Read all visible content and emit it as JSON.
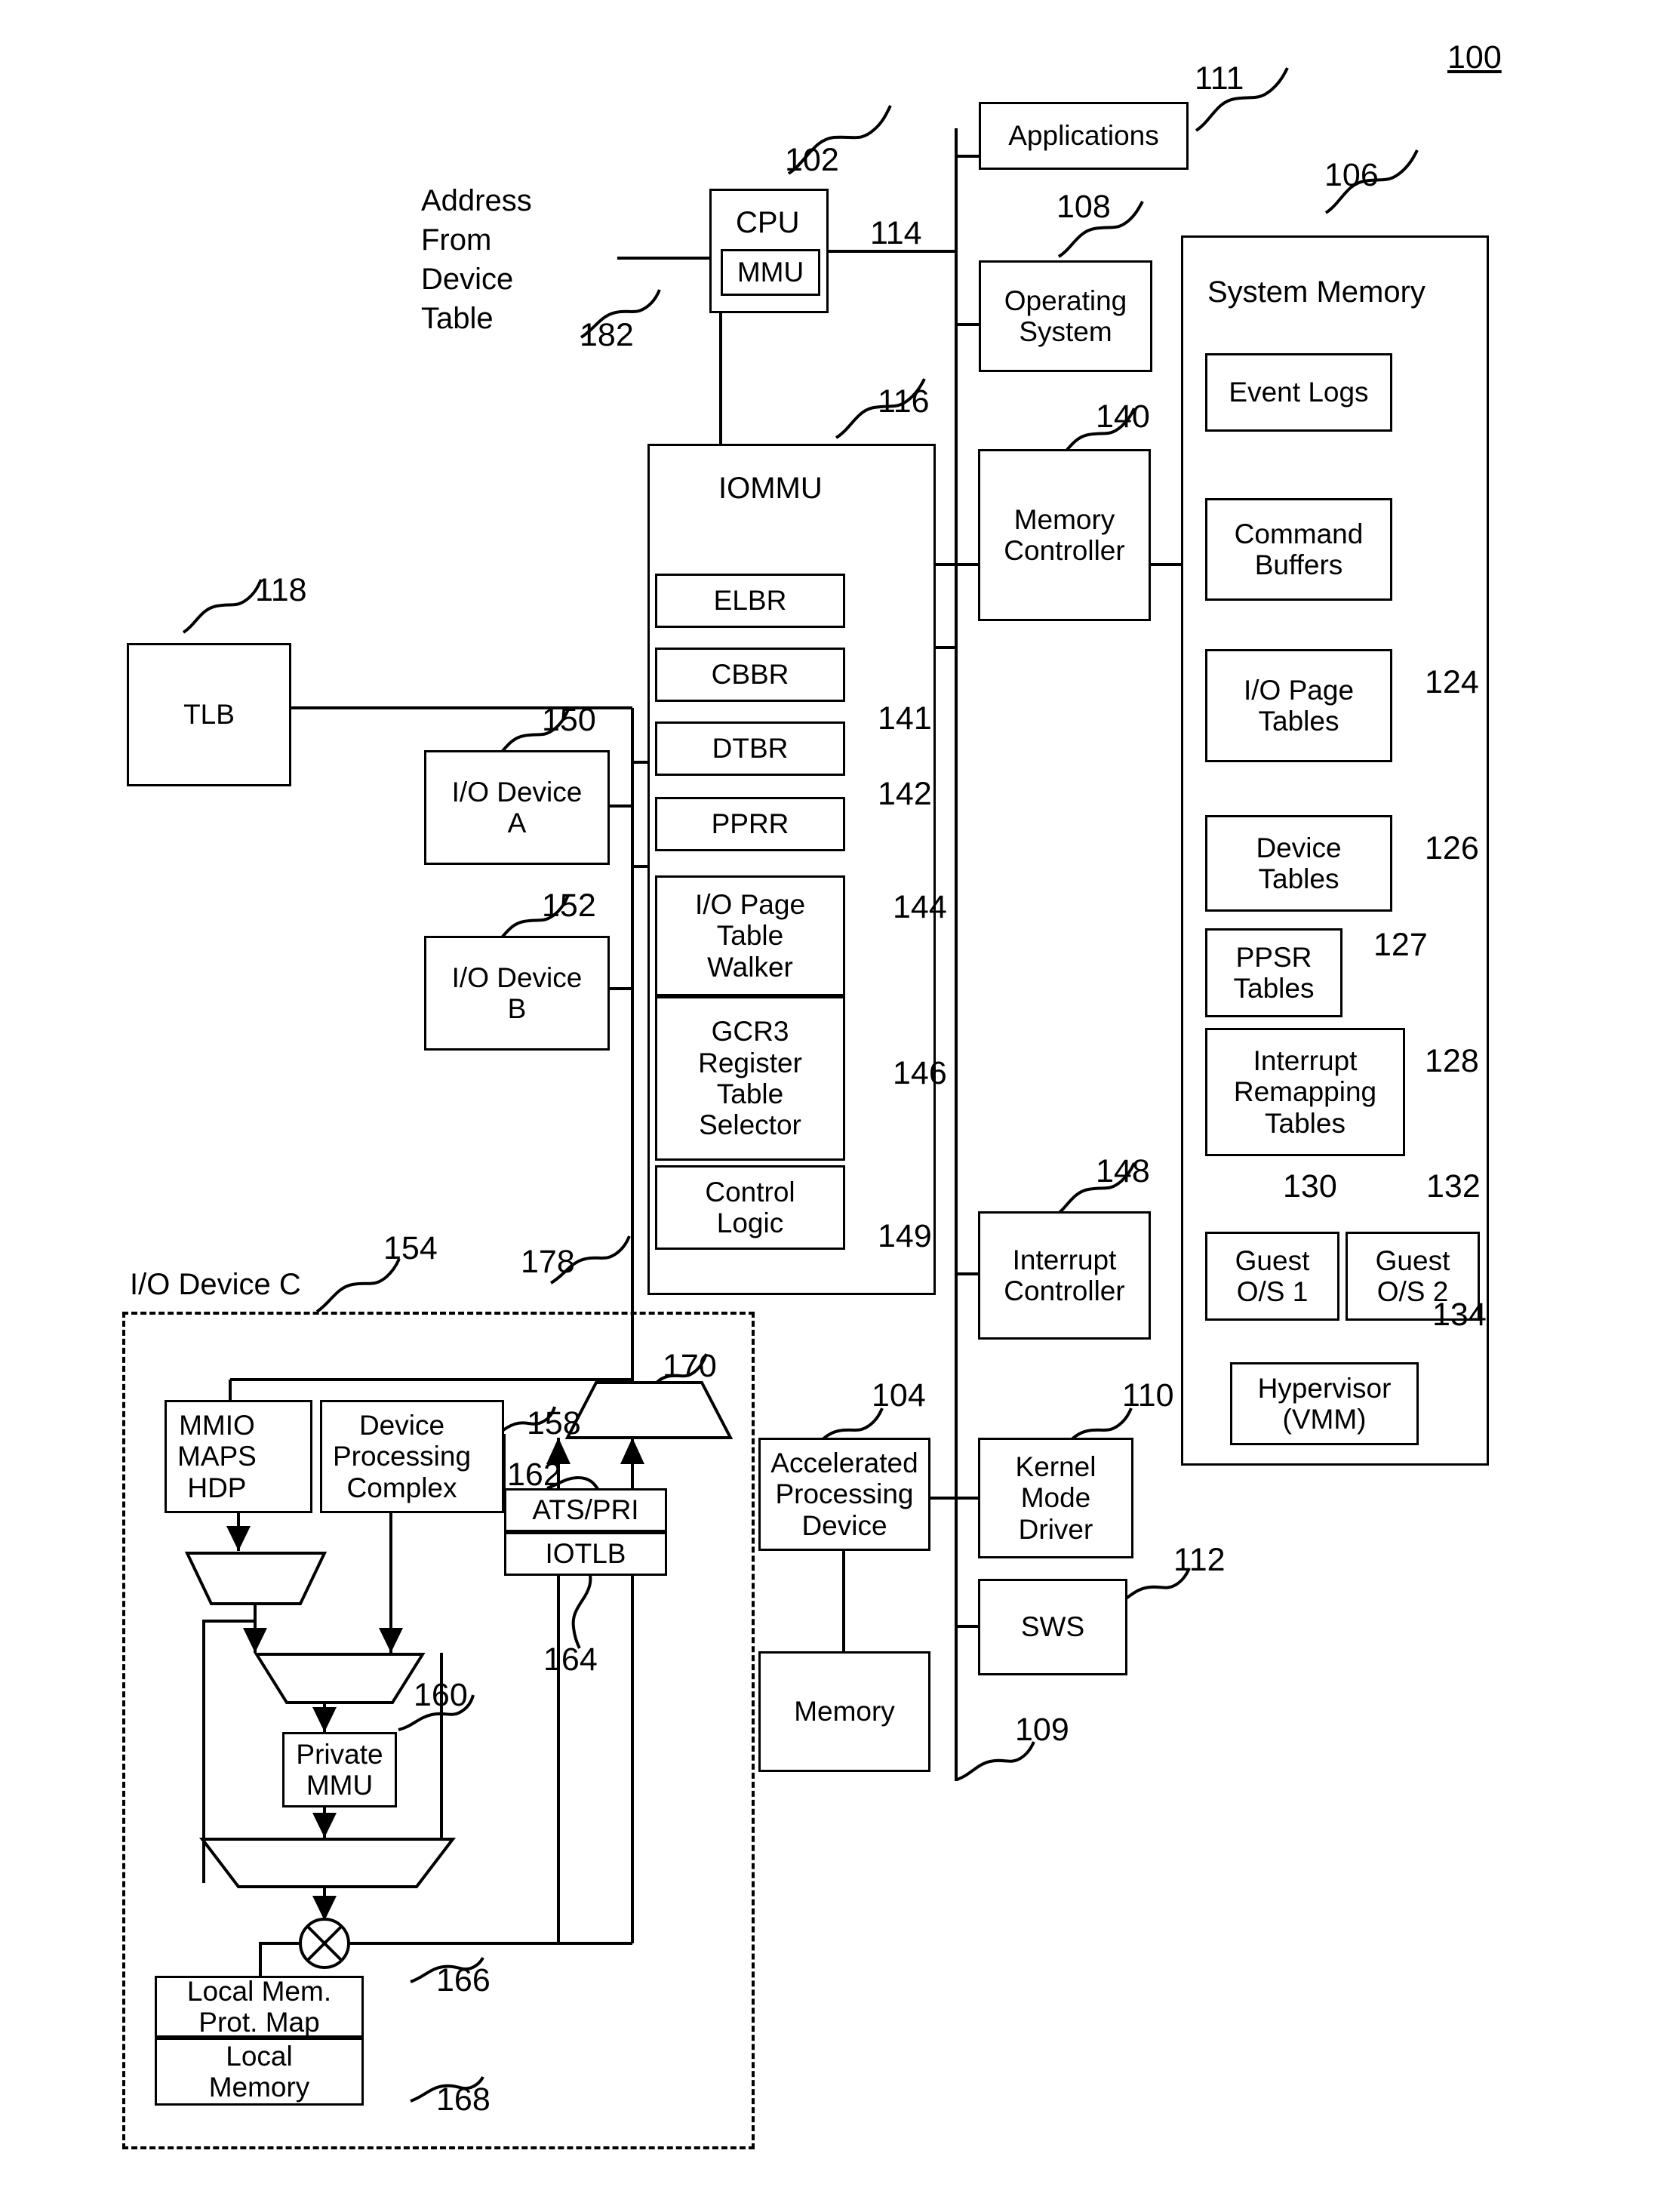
{
  "figure": {
    "number": "100",
    "address_note": "Address\nFrom\nDevice\nTable"
  },
  "blocks": {
    "cpu": {
      "label": "CPU",
      "ref": "102"
    },
    "mmu": {
      "label": "MMU",
      "ref": "114"
    },
    "applications": {
      "label": "Applications",
      "ref": "111"
    },
    "operating_system": {
      "label": "Operating\nSystem",
      "ref": "108"
    },
    "iommu": {
      "label": "IOMMU",
      "ref": "116"
    },
    "elbr": {
      "label": "ELBR",
      "ref": ""
    },
    "cbbr": {
      "label": "CBBR",
      "ref": ""
    },
    "dtbr": {
      "label": "DTBR",
      "ref": "141"
    },
    "pprr": {
      "label": "PPRR",
      "ref": "142"
    },
    "io_page_table_walker": {
      "label": "I/O Page\nTable\nWalker",
      "ref": "144"
    },
    "gcr3_register_table_selector": {
      "label": "GCR3\nRegister\nTable\nSelector",
      "ref": "146"
    },
    "control_logic": {
      "label": "Control\nLogic",
      "ref": "149"
    },
    "tlb": {
      "label": "TLB",
      "ref": "118"
    },
    "io_device_a": {
      "label": "I/O Device\nA",
      "ref": "150"
    },
    "io_device_b": {
      "label": "I/O Device\nB",
      "ref": "152"
    },
    "memory_controller": {
      "label": "Memory\nController",
      "ref": "140"
    },
    "interrupt_controller": {
      "label": "Interrupt\nController",
      "ref": "148"
    },
    "system_memory": {
      "label": "System Memory",
      "ref": "106"
    },
    "event_logs": {
      "label": "Event Logs",
      "ref": ""
    },
    "command_buffers": {
      "label": "Command\nBuffers",
      "ref": ""
    },
    "io_page_tables": {
      "label": "I/O Page\nTables",
      "ref": "124"
    },
    "device_tables": {
      "label": "Device\nTables",
      "ref": "126"
    },
    "ppsr_tables": {
      "label": "PPSR\nTables",
      "ref": "127"
    },
    "interrupt_remapping_tables": {
      "label": "Interrupt\nRemapping\nTables",
      "ref": "128"
    },
    "guest_os_1": {
      "label": "Guest\nO/S 1",
      "ref": "130"
    },
    "guest_os_2": {
      "label": "Guest\nO/S 2",
      "ref": "132"
    },
    "hypervisor": {
      "label": "Hypervisor\n(VMM)",
      "ref": "134"
    },
    "accelerated_processing_device": {
      "label": "Accelerated\nProcessing\nDevice",
      "ref": "104"
    },
    "apd_memory": {
      "label": "Memory",
      "ref": ""
    },
    "kernel_mode_driver": {
      "label": "Kernel\nMode\nDriver",
      "ref": "110"
    },
    "sws": {
      "label": "SWS",
      "ref": "112"
    },
    "io_device_c": {
      "label": "I/O Device C",
      "ref": "154"
    },
    "mmio_maps_hdp": {
      "label": "MMIO\nMAPS\nHDP",
      "ref": ""
    },
    "device_processing_complex": {
      "label": "Device\nProcessing\nComplex",
      "ref": "158"
    },
    "ats_pri": {
      "label": "ATS/PRI",
      "ref": "162"
    },
    "iotlb": {
      "label": "IOTLB",
      "ref": "164"
    },
    "private_mmu": {
      "label": "Private\nMMU",
      "ref": "160"
    },
    "local_mem_prot_map": {
      "label": "Local Mem.\nProt. Map",
      "ref": "166"
    },
    "local_memory": {
      "label": "Local\nMemory",
      "ref": "168"
    },
    "output_mux": {
      "label": "",
      "ref": "170"
    },
    "bus_109": {
      "label": "",
      "ref": "109"
    },
    "bus_178": {
      "label": "",
      "ref": "178"
    },
    "bus_182": {
      "label": "",
      "ref": "182"
    }
  },
  "refs": {
    "r100": "100",
    "r102": "102",
    "r104": "104",
    "r106": "106",
    "r108": "108",
    "r109": "109",
    "r110": "110",
    "r111": "111",
    "r112": "112",
    "r114": "114",
    "r116": "116",
    "r118": "118",
    "r124": "124",
    "r126": "126",
    "r127": "127",
    "r128": "128",
    "r130": "130",
    "r132": "132",
    "r134": "134",
    "r140": "140",
    "r141": "141",
    "r142": "142",
    "r144": "144",
    "r146": "146",
    "r148": "148",
    "r149": "149",
    "r150": "150",
    "r152": "152",
    "r154": "154",
    "r158": "158",
    "r160": "160",
    "r162": "162",
    "r164": "164",
    "r166": "166",
    "r168": "168",
    "r170": "170",
    "r178": "178",
    "r182": "182"
  }
}
